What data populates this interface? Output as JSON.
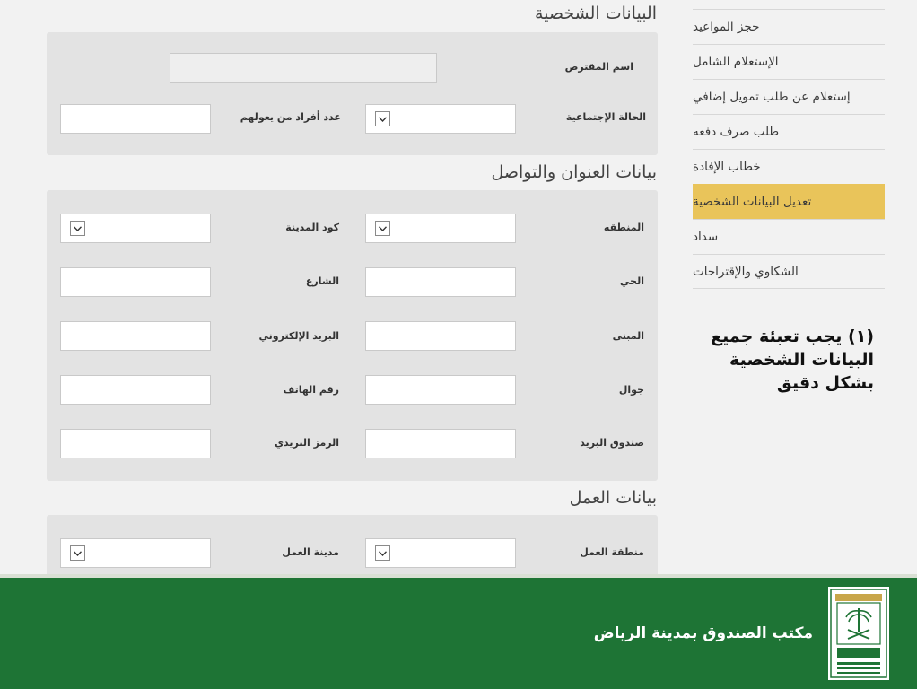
{
  "sidebar": {
    "items": [
      {
        "label": "حجز المواعيد"
      },
      {
        "label": "الإستعلام الشامل"
      },
      {
        "label": "إستعلام عن طلب تمويل إضافي"
      },
      {
        "label": "طلب صرف دفعه"
      },
      {
        "label": "خطاب الإفادة"
      },
      {
        "label": "تعديل البيانات الشخصية",
        "active": true
      },
      {
        "label": "سداد"
      },
      {
        "label": "الشكاوي والإقتراحات"
      }
    ],
    "note": "(١) يجب تعبئة جميع البيانات الشخصية بشكل دقيق"
  },
  "personal": {
    "title": "البيانات الشخصية",
    "borrower_name": {
      "label": "اسم المقترض",
      "value": ""
    },
    "marital_status": {
      "label": "الحالة الإجتماعية",
      "value": ""
    },
    "dependents": {
      "label": "عدد أفراد من يعولهم",
      "value": ""
    }
  },
  "address": {
    "title": "بيانات العنوان والتواصل",
    "region": {
      "label": "المنطقه",
      "value": ""
    },
    "city_code": {
      "label": "كود المدينة",
      "value": ""
    },
    "district": {
      "label": "الحي",
      "value": ""
    },
    "street": {
      "label": "الشارع",
      "value": ""
    },
    "building": {
      "label": "المبنى",
      "value": ""
    },
    "email": {
      "label": "البريد الإلكتروني",
      "value": ""
    },
    "mobile": {
      "label": "جوال",
      "value": ""
    },
    "phone": {
      "label": "رقم الهاتف",
      "value": ""
    },
    "po_box": {
      "label": "صندوق البريد",
      "value": ""
    },
    "postal_code": {
      "label": "الرمز البريدي",
      "value": ""
    }
  },
  "work": {
    "title": "بيانات العمل",
    "work_region": {
      "label": "منطقة العمل",
      "value": ""
    },
    "work_city": {
      "label": "مدينة العمل",
      "value": ""
    }
  },
  "footer": {
    "title": "مكتب الصندوق بمدينة الرياض",
    "logo_icon": "fund-logo-icon"
  },
  "colors": {
    "active_nav": "#e9c45a",
    "footer": "#1e7435",
    "panel": "#e3e3e3"
  }
}
